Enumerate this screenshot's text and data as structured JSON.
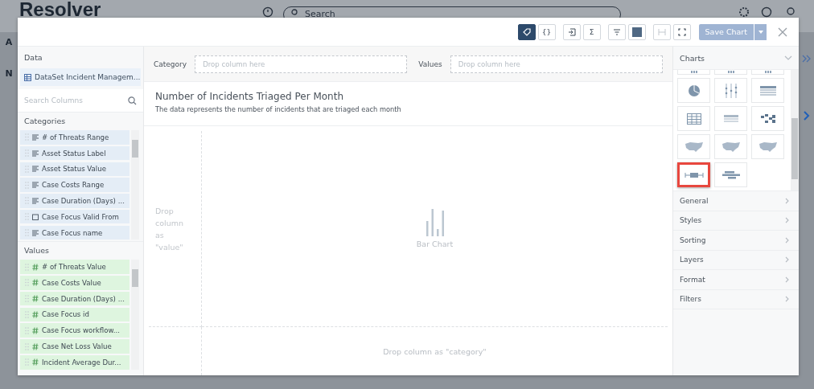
{
  "background": {
    "logo": "Resolver",
    "search": {
      "placeholder": "Search"
    },
    "side_letters": [
      "A",
      "N"
    ]
  },
  "toolbar": {
    "tools": [
      {
        "kind": "tag",
        "selected": true
      },
      {
        "kind": "braces",
        "label": "{}",
        "selected": false
      },
      {
        "kind": "export",
        "selected": false
      },
      {
        "kind": "sigma",
        "label": "Σ",
        "selected": false
      },
      {
        "kind": "filter",
        "selected": false
      },
      {
        "kind": "fill",
        "selected": false
      },
      {
        "kind": "width",
        "selected": false
      },
      {
        "kind": "expand",
        "selected": false
      }
    ],
    "save_button": {
      "label": "Save Chart",
      "disabled": true
    }
  },
  "data_panel": {
    "title": "Data",
    "dataset": "DataSet Incident Managem...",
    "search": {
      "placeholder": "Search Columns"
    },
    "categories": {
      "title": "Categories",
      "items": [
        {
          "label": "# of Threats Range",
          "kind": "text"
        },
        {
          "label": "Asset Status Label",
          "kind": "text"
        },
        {
          "label": "Asset Status Value",
          "kind": "text"
        },
        {
          "label": "Case Costs Range",
          "kind": "text"
        },
        {
          "label": "Case Duration (Days) ...",
          "kind": "text"
        },
        {
          "label": "Case Focus Valid From",
          "kind": "date"
        },
        {
          "label": "Case Focus name",
          "kind": "text"
        }
      ]
    },
    "values": {
      "title": "Values",
      "items": [
        {
          "label": "# of Threats Value"
        },
        {
          "label": "Case Costs Value"
        },
        {
          "label": "Case Duration (Days) ..."
        },
        {
          "label": "Case Focus id"
        },
        {
          "label": "Case Focus workflow..."
        },
        {
          "label": "Case Net Loss Value"
        },
        {
          "label": "Incident Average Dur..."
        }
      ]
    }
  },
  "drop_bar": {
    "category": {
      "label": "Category",
      "placeholder": "Drop column here"
    },
    "values": {
      "label": "Values",
      "placeholder": "Drop column here"
    }
  },
  "chart": {
    "title": "Number of Incidents Triaged Per Month",
    "description": "The data represents the number of incidents that are triaged each month",
    "value_drop": "Drop column as \"value\"",
    "type_label": "Bar Chart",
    "category_drop": "Drop column as \"category\""
  },
  "charts_panel": {
    "title": "Charts",
    "thumbnails": [
      {
        "kind": "partial",
        "selected": false
      },
      {
        "kind": "partial",
        "selected": false
      },
      {
        "kind": "partial",
        "selected": false
      },
      {
        "kind": "pie",
        "selected": false
      },
      {
        "kind": "dots",
        "selected": false
      },
      {
        "kind": "table",
        "selected": false
      },
      {
        "kind": "grid",
        "selected": false
      },
      {
        "kind": "pivot",
        "selected": false
      },
      {
        "kind": "heatmap",
        "selected": false
      },
      {
        "kind": "map",
        "selected": false
      },
      {
        "kind": "map",
        "selected": false
      },
      {
        "kind": "map",
        "selected": false
      },
      {
        "kind": "boxplot",
        "selected": true
      },
      {
        "kind": "gantt",
        "selected": false
      }
    ],
    "sections": [
      "General",
      "Styles",
      "Sorting",
      "Layers",
      "Format",
      "Filters"
    ]
  }
}
